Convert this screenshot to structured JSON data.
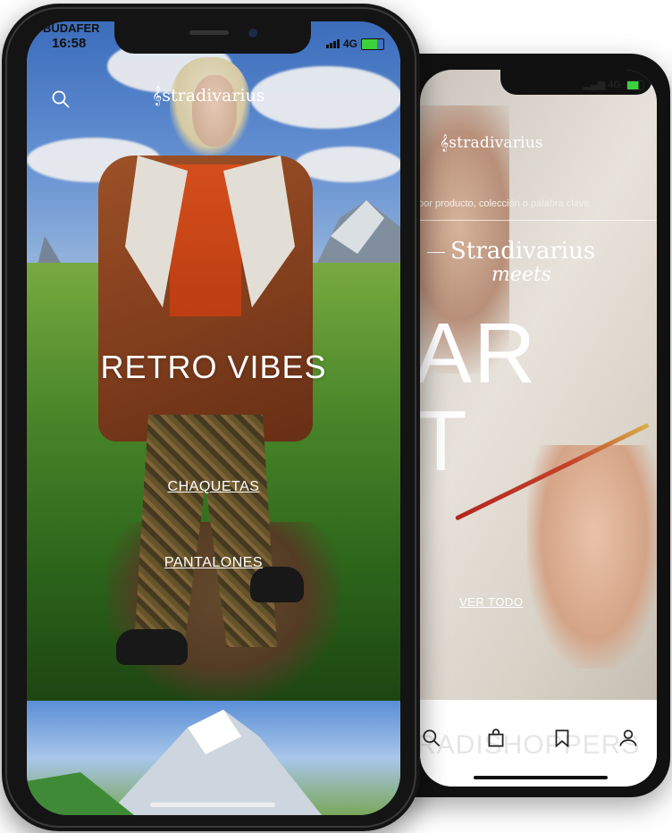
{
  "back_phone": {
    "status": {
      "network": "4G"
    },
    "brand": "stradivarius",
    "search_placeholder": "por producto, colección o palabra clave",
    "campaign_line1": "Stradivarius",
    "campaign_line2": "meets",
    "hero_word1": "AR",
    "hero_word2": "T",
    "cta": "VER TODO",
    "watermark": "RADISHOPPERS",
    "tabs": [
      "search",
      "bag",
      "saved",
      "account"
    ]
  },
  "front_phone": {
    "status": {
      "carrier": "BUDAFER",
      "time": "16:58",
      "network": "4G"
    },
    "brand": "stradivarius",
    "hero_title": "RETRO VIBES",
    "links": [
      "CHAQUETAS",
      "PANTALONES"
    ]
  },
  "colors": {
    "sky": "#4a7ecb",
    "jacket": "#8c4420",
    "sweater": "#d8491a",
    "text_on_image": "#ffffff"
  }
}
